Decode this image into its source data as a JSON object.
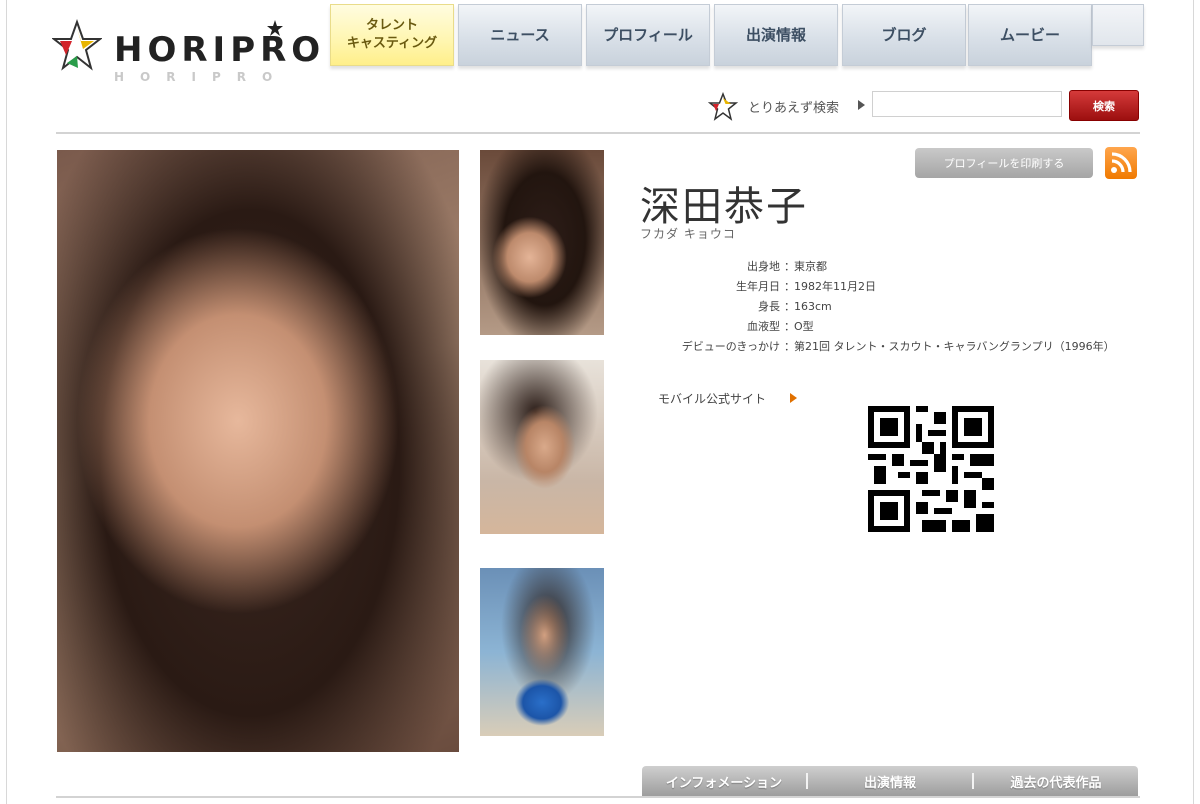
{
  "logo": {
    "text": "HORIPRO",
    "sub": "HORIPRO"
  },
  "nav": {
    "tabs": [
      {
        "label": "タレント\nキャスティング",
        "active": true
      },
      {
        "label": "ニュース"
      },
      {
        "label": "プロフィール"
      },
      {
        "label": "出演情報"
      },
      {
        "label": "ブログ"
      },
      {
        "label": "ムービー"
      }
    ]
  },
  "search": {
    "label": "とりあえず検索",
    "button": "検索",
    "value": ""
  },
  "profile": {
    "print_button": "プロフィールを印刷する",
    "name": "深田恭子",
    "kana": "フカダ キョウコ",
    "fields": [
      {
        "key": "出身地",
        "value": "東京都"
      },
      {
        "key": "生年月日",
        "value": "1982年11月2日"
      },
      {
        "key": "身長",
        "value": "163cm"
      },
      {
        "key": "血液型",
        "value": "O型"
      },
      {
        "key": "デビューのきっかけ",
        "value": "第21回 タレント・スカウト・キャラバングランプリ（1996年）"
      }
    ],
    "mobile_site": "モバイル公式サイト"
  },
  "bottom_tabs": [
    "インフォメーション",
    "出演情報",
    "過去の代表作品"
  ],
  "colors": {
    "accent_red": "#b31515",
    "rss_orange": "#f58a1f",
    "active_tab": "#fff6b0"
  }
}
